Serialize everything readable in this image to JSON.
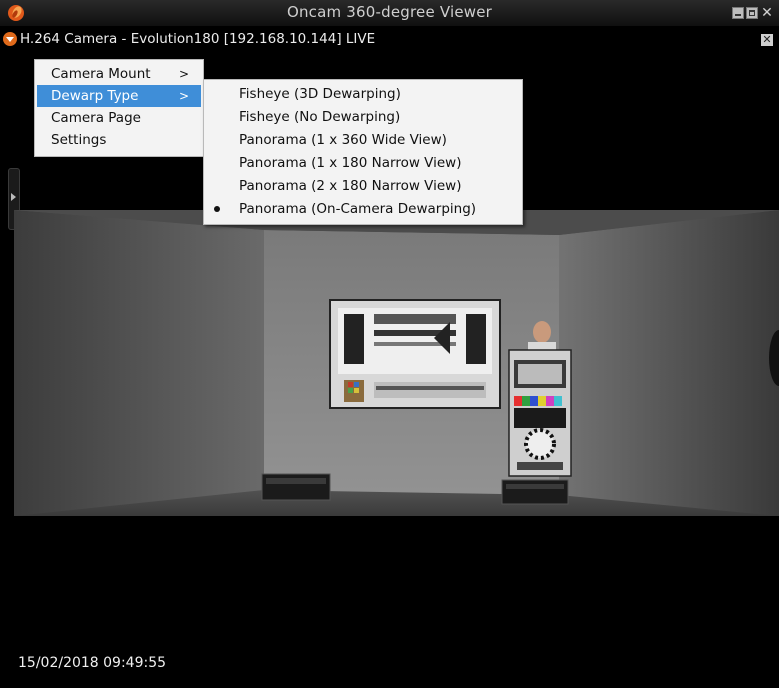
{
  "window": {
    "title": "Oncam 360-degree Viewer"
  },
  "camera_bar": {
    "title": "H.264 Camera - Evolution180 [192.168.10.144] LIVE"
  },
  "context_menu": {
    "items": [
      {
        "label": "Camera Mount",
        "has_submenu": true
      },
      {
        "label": "Dewarp Type",
        "has_submenu": true,
        "highlighted": true
      },
      {
        "label": "Camera Page",
        "has_submenu": false
      },
      {
        "label": "Settings",
        "has_submenu": false
      }
    ],
    "arrow_glyph": ">"
  },
  "dewarp_submenu": {
    "items": [
      {
        "label": "Fisheye (3D Dewarping)",
        "selected": false
      },
      {
        "label": "Fisheye (No Dewarping)",
        "selected": false
      },
      {
        "label": "Panorama (1 x 360 Wide View)",
        "selected": false
      },
      {
        "label": "Panorama (1 x 180 Narrow View)",
        "selected": false
      },
      {
        "label": "Panorama (2 x 180 Narrow View)",
        "selected": false
      },
      {
        "label": "Panorama (On-Camera Dewarping)",
        "selected": true
      }
    ]
  },
  "video": {
    "timestamp": "15/02/2018 09:49:55"
  },
  "colors": {
    "accent_orange": "#e06a1b",
    "menu_highlight": "#3f8ed8",
    "menu_background": "#f3f3f3"
  }
}
